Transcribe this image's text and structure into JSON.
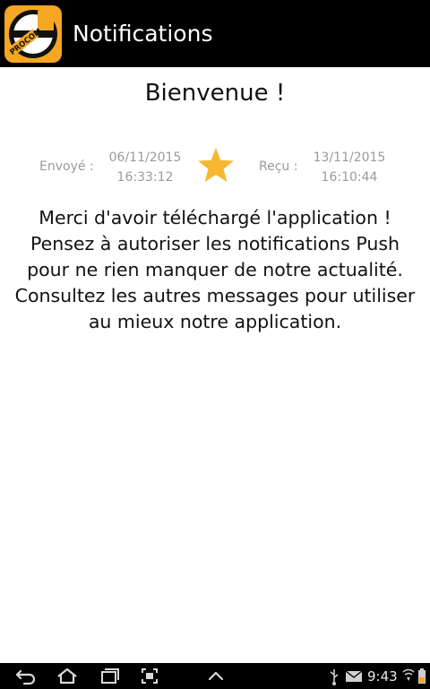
{
  "action_bar": {
    "logo_text": "PROCOM",
    "title": "Notifications"
  },
  "message": {
    "title": "Bienvenue !",
    "sent_label": "Envoyé :",
    "sent_date": "06/11/2015",
    "sent_time": "16:33:12",
    "received_label": "Reçu :",
    "received_date": "13/11/2015",
    "received_time": "16:10:44",
    "body_lines": [
      "Merci d'avoir téléchargé l'application !",
      "Pensez à autoriser les notifications Push",
      "pour ne rien manquer de notre actualité.",
      "Consultez les autres messages pour utiliser",
      "au mieux notre application."
    ],
    "favorite": true
  },
  "system_bar": {
    "time": "9:43",
    "nav_icons": [
      "back-icon",
      "home-icon",
      "recent-apps-icon",
      "screenshot-icon",
      "chevron-up-icon"
    ],
    "status_icons": [
      "usb-icon",
      "email-icon",
      "wifi-icon",
      "battery-icon"
    ]
  },
  "colors": {
    "action_bar_bg": "#000000",
    "logo_orange": "#F5A623",
    "star_color": "#F7B731",
    "meta_text": "#9A9A9A",
    "body_text": "#111111"
  }
}
